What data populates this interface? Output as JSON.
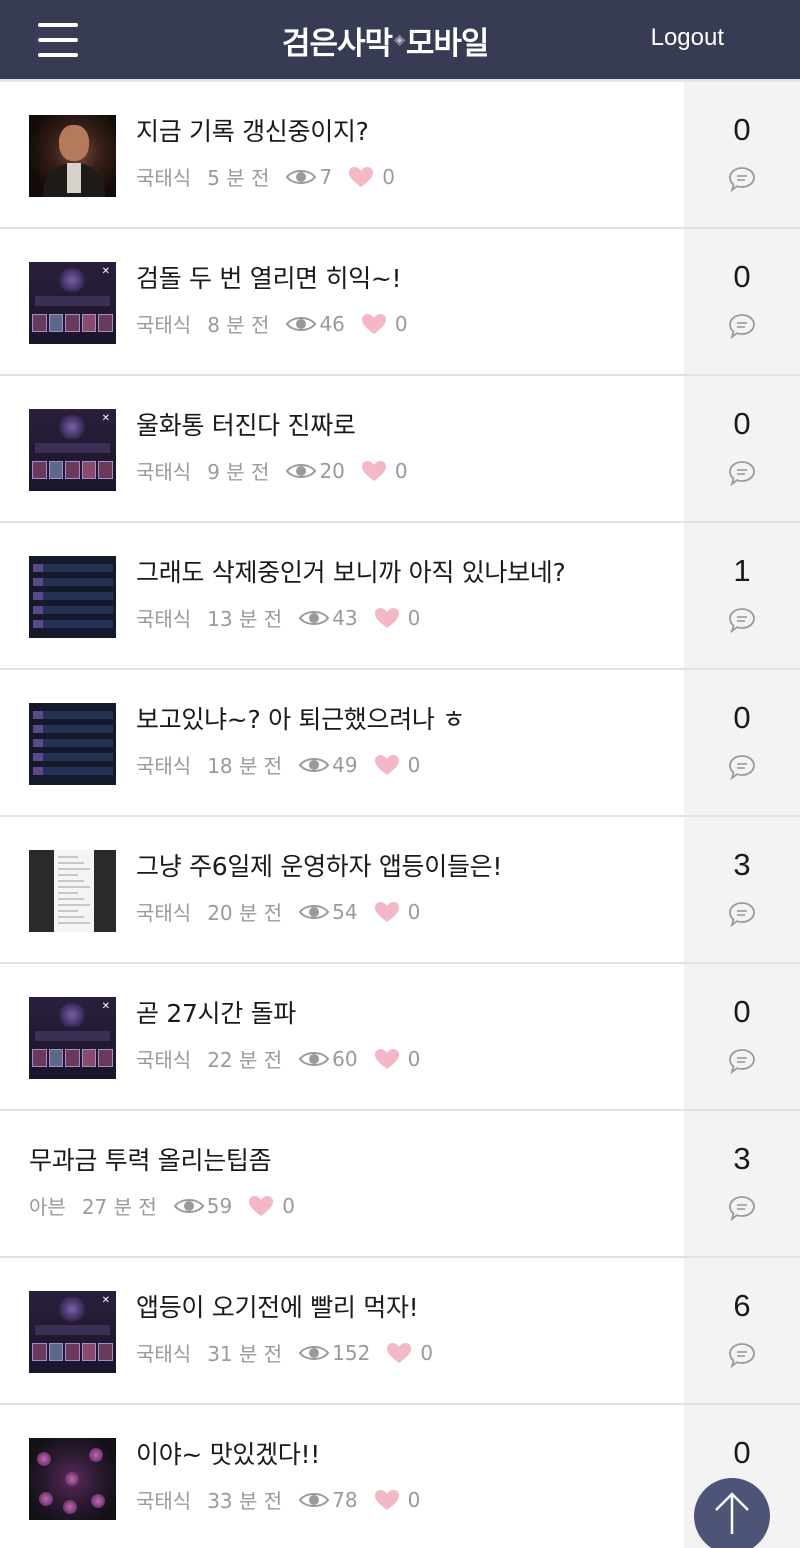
{
  "header": {
    "logo_left": "검은사막",
    "logo_right": "모바일",
    "logout_label": "Logout",
    "menu_icon": "hamburger-icon"
  },
  "colors": {
    "header_bg": "#383b54",
    "side_bg": "#f3f3f3",
    "heart": "#f2b8c6",
    "meta_text": "#9a9a9a",
    "top_button": "#4d5475"
  },
  "posts": [
    {
      "title": "지금 기록 갱신중이지?",
      "author": "국태식",
      "time": "5 분 전",
      "views": "7",
      "likes": "0",
      "comments": "0",
      "thumb": "photo"
    },
    {
      "title": "검돌 두 번 열리면 히익~!",
      "author": "국태식",
      "time": "8 분 전",
      "views": "46",
      "likes": "0",
      "comments": "0",
      "thumb": "game"
    },
    {
      "title": "울화통 터진다 진짜로",
      "author": "국태식",
      "time": "9 분 전",
      "views": "20",
      "likes": "0",
      "comments": "0",
      "thumb": "game"
    },
    {
      "title": "그래도 삭제중인거 보니까 아직 있나보네?",
      "author": "국태식",
      "time": "13 분 전",
      "views": "43",
      "likes": "0",
      "comments": "1",
      "thumb": "list"
    },
    {
      "title": "보고있냐~? 아 퇴근했으려나 ㅎ",
      "author": "국태식",
      "time": "18 분 전",
      "views": "49",
      "likes": "0",
      "comments": "0",
      "thumb": "list"
    },
    {
      "title": "그냥 주6일제 운영하자 앱등이들은!",
      "author": "국태식",
      "time": "20 분 전",
      "views": "54",
      "likes": "0",
      "comments": "3",
      "thumb": "doc"
    },
    {
      "title": "곧 27시간 돌파",
      "author": "국태식",
      "time": "22 분 전",
      "views": "60",
      "likes": "0",
      "comments": "0",
      "thumb": "game"
    },
    {
      "title": "무과금 투력 올리는팁좀",
      "author": "아븐",
      "time": "27 분 전",
      "views": "59",
      "likes": "0",
      "comments": "3",
      "thumb": "none"
    },
    {
      "title": "앱등이 오기전에 빨리 먹자!",
      "author": "국태식",
      "time": "31 분 전",
      "views": "152",
      "likes": "0",
      "comments": "6",
      "thumb": "game"
    },
    {
      "title": "이야~ 맛있겠다!!",
      "author": "국태식",
      "time": "33 분 전",
      "views": "78",
      "likes": "0",
      "comments": "0",
      "thumb": "boss"
    }
  ],
  "icons": {
    "views": "eye-icon",
    "likes": "heart-icon",
    "comments": "comment-bubble-icon",
    "scroll_top": "arrow-up-icon"
  }
}
